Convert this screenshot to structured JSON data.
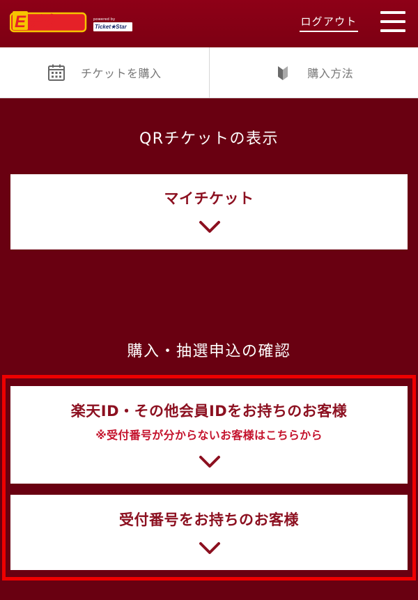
{
  "header": {
    "logo_text": "Eチケ",
    "powered_by": "powered by",
    "powered_brand": "Ticket★Star",
    "logout_label": "ログアウト"
  },
  "nav": {
    "buy_ticket_label": "チケットを購入",
    "how_to_buy_label": "購入方法"
  },
  "qr_section": {
    "title": "QRチケットの表示",
    "my_ticket_label": "マイチケット"
  },
  "confirm_section": {
    "title": "購入・抽選申込の確認",
    "rakuten_title": "楽天ID・その他会員IDをお持ちのお客様",
    "rakuten_note": "※受付番号が分からないお客様はこちらから",
    "receipt_title": "受付番号をお持ちのお客様"
  },
  "colors": {
    "background": "#690011",
    "header": "#8e0017",
    "card_title": "#8c1020",
    "card_note": "#c4122c",
    "highlight_frame": "#ee0000"
  }
}
